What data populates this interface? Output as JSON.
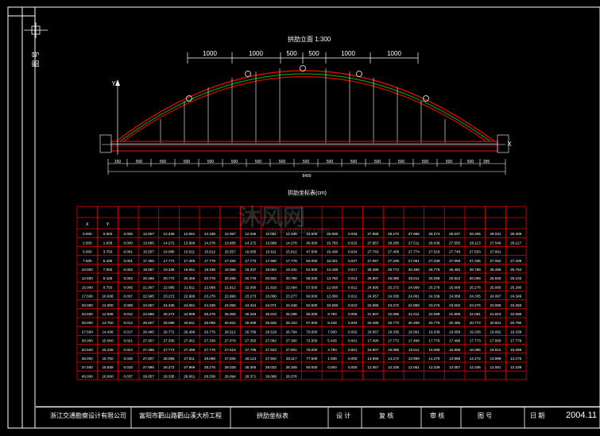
{
  "drawing": {
    "elevation_title": "拱肋立面 1:300",
    "table_title": "拱肋坐标表(cm)",
    "side_label": "图 号",
    "axis_x": "X",
    "axis_y": "Y",
    "top_dims": [
      "1000",
      "1000",
      "500",
      "500",
      "1000",
      "1000"
    ],
    "bottom_dims": [
      "150",
      "500",
      "500",
      "500",
      "500",
      "500",
      "500",
      "500",
      "500",
      "500",
      "500",
      "500",
      "500",
      "500",
      "500",
      "500",
      "395",
      "150",
      "400",
      "100"
    ],
    "total_dim": "8400",
    "watermark": "沐风网",
    "watermark_url": "www.mfcad.com"
  },
  "table": {
    "columns": [
      "X",
      "Y",
      "",
      "",
      "",
      "",
      "",
      "",
      "",
      "",
      "",
      "",
      "",
      "",
      "",
      "",
      "",
      "",
      "",
      "",
      "",
      "",
      ""
    ],
    "rows": [
      [
        "0.000",
        "0.000",
        "0.000",
        "12.057",
        "12.335",
        "12.061",
        "12.338",
        "12.057",
        "12.335",
        "12.061",
        "12.338",
        "42.500",
        "15.938",
        "0.033",
        "27.985",
        "28.272",
        "27.988",
        "28.274",
        "28.037",
        "28.305",
        "28.031",
        "28.309"
      ],
      [
        "2.500",
        "1.938",
        "0.000",
        "13.685",
        "14.272",
        "13.689",
        "14.278",
        "13.685",
        "14.272",
        "13.689",
        "14.278",
        "45.000",
        "15.750",
        "0.023",
        "27.857",
        "28.265",
        "27.511",
        "28.039",
        "27.555",
        "28.113",
        "27.540",
        "28.117"
      ],
      [
        "5.000",
        "3.750",
        "0.001",
        "15.557",
        "16.085",
        "15.611",
        "15.812",
        "15.557",
        "16.085",
        "15.611",
        "15.812",
        "47.500",
        "15.438",
        "0.024",
        "27.763",
        "27.405",
        "27.774",
        "27.518",
        "27.748",
        "27.553",
        "27.691"
      ],
      [
        "7.500",
        "5.438",
        "0.001",
        "17.465",
        "17.772",
        "17.469",
        "17.778",
        "17.465",
        "17.773",
        "17.590",
        "17.778",
        "50.000",
        "15.001",
        "0.027",
        "27.057",
        "27.335",
        "27.061",
        "27.339",
        "27.058",
        "27.335",
        "27.062",
        "27.339"
      ],
      [
        "10.000",
        "7.000",
        "0.002",
        "19.057",
        "19.336",
        "19.061",
        "19.338",
        "19.058",
        "19.337",
        "19.064",
        "19.341",
        "52.500",
        "14.438",
        "0.017",
        "26.495",
        "26.772",
        "26.499",
        "26.776",
        "26.492",
        "26.768",
        "26.496",
        "26.784"
      ],
      [
        "12.500",
        "8.438",
        "0.004",
        "20.495",
        "20.772",
        "20.459",
        "20.776",
        "20.498",
        "20.776",
        "20.502",
        "20.780",
        "55.000",
        "13.750",
        "0.014",
        "25.807",
        "26.085",
        "25.811",
        "26.088",
        "25.822",
        "26.099",
        "25.826",
        "26.103"
      ],
      [
        "15.000",
        "9.750",
        "0.005",
        "21.807",
        "22.085",
        "21.811",
        "22.088",
        "21.812",
        "22.090",
        "21.816",
        "22.094",
        "57.500",
        "12.938",
        "0.012",
        "24.995",
        "25.272",
        "24.999",
        "25.276",
        "25.000",
        "25.276",
        "25.005",
        "25.280"
      ],
      [
        "17.500",
        "10.938",
        "0.007",
        "22.995",
        "23.272",
        "22.999",
        "23.276",
        "22.996",
        "23.273",
        "23.000",
        "23.277",
        "60.000",
        "12.000",
        "0.012",
        "24.057",
        "24.335",
        "24.061",
        "24.339",
        "24.058",
        "24.335",
        "24.067",
        "24.349"
      ],
      [
        "20.000",
        "12.000",
        "0.009",
        "24.057",
        "24.335",
        "24.061",
        "24.339",
        "24.058",
        "24.344",
        "24.071",
        "24.348",
        "62.500",
        "10.938",
        "0.012",
        "22.995",
        "23.272",
        "22.999",
        "23.276",
        "23.002",
        "23.276",
        "23.006",
        "23.283"
      ],
      [
        "22.500",
        "12.938",
        "0.012",
        "24.995",
        "25.272",
        "24.999",
        "25.276",
        "25.008",
        "25.284",
        "25.010",
        "25.288",
        "65.000",
        "9.750",
        "0.005",
        "21.807",
        "22.085",
        "21.811",
        "22.089",
        "21.809",
        "22.081",
        "21.813",
        "22.086"
      ],
      [
        "25.000",
        "13.750",
        "0.014",
        "25.807",
        "26.085",
        "25.811",
        "26.088",
        "25.822",
        "26.099",
        "25.826",
        "26.103",
        "67.500",
        "8.438",
        "0.004",
        "20.495",
        "20.772",
        "20.499",
        "20.776",
        "20.496",
        "20.773",
        "20.501",
        "20.780"
      ],
      [
        "27.500",
        "14.438",
        "0.017",
        "26.495",
        "26.772",
        "26.499",
        "26.776",
        "26.512",
        "26.789",
        "26.516",
        "26.794",
        "70.000",
        "7.000",
        "0.002",
        "19.057",
        "19.335",
        "19.061",
        "19.339",
        "19.058",
        "19.336",
        "19.062",
        "19.339"
      ],
      [
        "30.000",
        "15.000",
        "0.021",
        "27.057",
        "27.335",
        "27.061",
        "27.339",
        "27.078",
        "27.355",
        "27.082",
        "27.360",
        "72.500",
        "5.438",
        "0.001",
        "17.495",
        "17.772",
        "17.499",
        "17.776",
        "17.496",
        "17.773",
        "17.500",
        "17.778"
      ],
      [
        "32.500",
        "15.438",
        "0.024",
        "27.495",
        "27.772",
        "27.499",
        "27.776",
        "27.519",
        "27.796",
        "27.523",
        "27.801",
        "75.000",
        "3.750",
        "0.001",
        "15.807",
        "16.085",
        "15.811",
        "16.089",
        "15.808",
        "16.085",
        "15.812",
        "16.089"
      ],
      [
        "35.000",
        "15.750",
        "0.028",
        "27.807",
        "28.085",
        "27.811",
        "28.088",
        "27.835",
        "28.113",
        "27.840",
        "28.117",
        "77.500",
        "1.938",
        "0.000",
        "13.995",
        "14.272",
        "13.999",
        "14.276",
        "13.995",
        "14.272",
        "13.999",
        "14.276"
      ],
      [
        "37.500",
        "15.938",
        "0.033",
        "27.995",
        "28.272",
        "27.999",
        "28.276",
        "28.028",
        "28.305",
        "28.032",
        "28.309",
        "80.000",
        "0.000",
        "0.000",
        "12.057",
        "12.335",
        "12.061",
        "12.339",
        "12.057",
        "12.335",
        "12.061",
        "12.339"
      ],
      [
        "40.000",
        "16.000",
        "0.037",
        "28.057",
        "28.335",
        "28.061",
        "28.339",
        "28.094",
        "28.371",
        "28.098",
        "28.376",
        "",
        "",
        "",
        "",
        "",
        "",
        "",
        "",
        "",
        "",
        ""
      ]
    ]
  },
  "title_block": {
    "company": "浙江交通勘察设计有限公司",
    "project": "富阳市鹳山路鹳山溪大桥工程",
    "sheet": "拱肋坐标表",
    "design": "设 计",
    "check": "复 核",
    "review": "审 核",
    "drawing_no": "图 号",
    "date_label": "日 期",
    "date": "2004.11"
  }
}
